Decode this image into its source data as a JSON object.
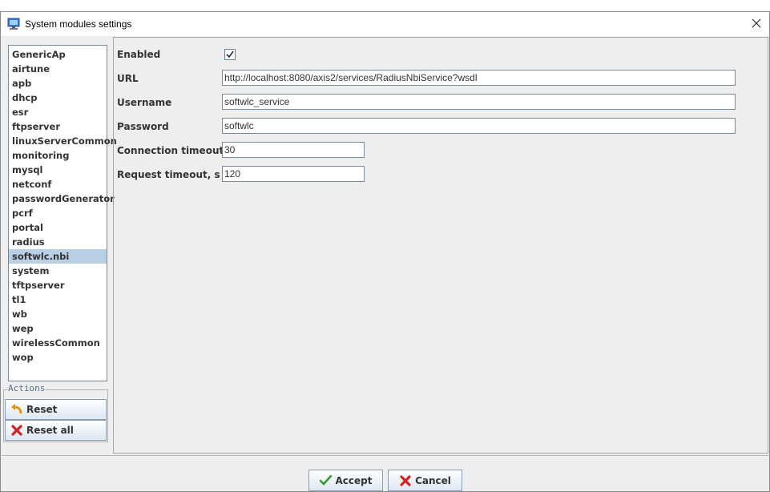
{
  "window": {
    "title": "System modules settings"
  },
  "modules": [
    "GenericAp",
    "airtune",
    "apb",
    "dhcp",
    "esr",
    "ftpserver",
    "linuxServerCommon",
    "monitoring",
    "mysql",
    "netconf",
    "passwordGenerator",
    "pcrf",
    "portal",
    "radius",
    "softwlc.nbi",
    "system",
    "tftpserver",
    "tl1",
    "wb",
    "wep",
    "wirelessCommon",
    "wop"
  ],
  "selected_module": "softwlc.nbi",
  "actions": {
    "legend": "Actions",
    "reset_label": "Reset",
    "reset_all_label": "Reset all"
  },
  "settings": {
    "enabled_label": "Enabled",
    "enabled_checked": true,
    "url_label": "URL",
    "url_value": "http://localhost:8080/axis2/services/RadiusNbiService?wsdl",
    "username_label": "Username",
    "username_value": "softwlc_service",
    "password_label": "Password",
    "password_value": "softwlc",
    "conn_timeout_label": "Connection timeout, s",
    "conn_timeout_value": "30",
    "req_timeout_label": "Request timeout, s",
    "req_timeout_value": "120"
  },
  "buttons": {
    "accept_label": "Accept",
    "cancel_label": "Cancel"
  },
  "colors": {
    "selection": "#b8cfe5",
    "accept_check": "#3c9a2b",
    "cancel_x": "#d42020",
    "reset_arrow": "#e0a020"
  },
  "icons": {
    "app": "monitor-icon",
    "close": "close-icon",
    "reset": "undo-arrow-icon",
    "reset_all": "red-x-icon",
    "accept": "green-check-icon",
    "cancel": "red-x-icon"
  }
}
